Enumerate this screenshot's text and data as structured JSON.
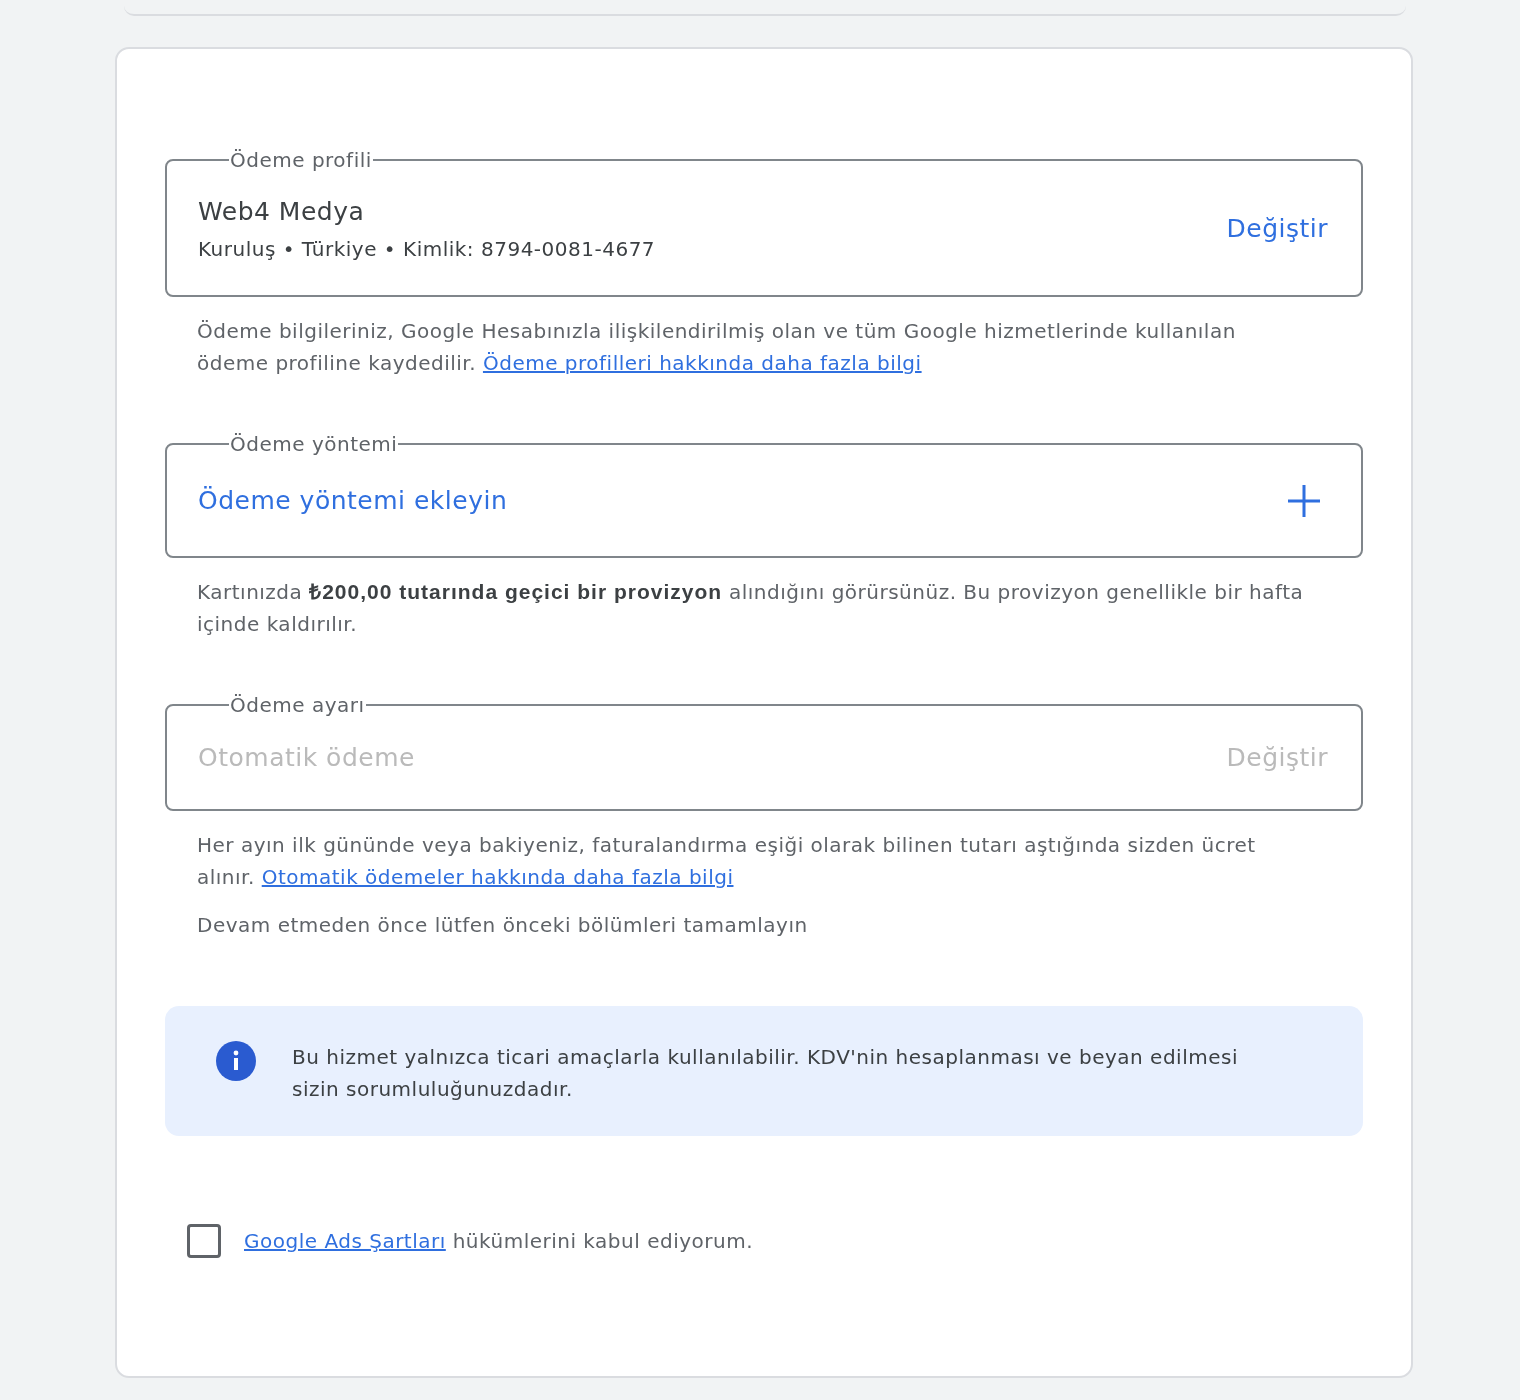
{
  "sections": [
    {
      "kind": "profile",
      "label": "Ödeme profili",
      "title": "Web4 Medya",
      "details": "Kuruluş • Türkiye • Kimlik: 8794-0081-4677",
      "action": "Değiştir",
      "disabled": false,
      "note": "Ödeme bilgileriniz, Google Hesabınızla ilişkilendirilmiş olan ve tüm Google hizmetlerinde kullanılan ödeme profiline kaydedilir.",
      "note_link": "Ödeme profilleri hakkında daha fazla bilgi"
    },
    {
      "kind": "add",
      "label": "Ödeme yöntemi",
      "title": "Ödeme yöntemi ekleyin",
      "disabled": false,
      "note": "Kartınızda **₺200,00 tutarında geçici bir provizyon** alındığını görürsünüz. Bu provizyon genellikle bir hafta içinde kaldırılır."
    },
    {
      "kind": "setting",
      "label": "Ödeme ayarı",
      "title": "Otomatik ödeme",
      "action": "Değiştir",
      "disabled": true,
      "note": "Her ayın ilk gününde veya bakiyeniz, faturalandırma eşiği olarak bilinen tutarı aştığında sizden ücret alınır.",
      "note_link": "Otomatik ödemeler hakkında daha fazla bilgi",
      "hint": "Devam etmeden önce lütfen önceki bölümleri tamamlayın"
    }
  ],
  "info": {
    "text": "Bu hizmet yalnızca ticari amaçlarla kullanılabilir. KDV'nin hesaplanması ve beyan edilmesi sizin sorumluluğunuzdadır."
  },
  "terms": {
    "checked": false,
    "link": "Google Ads Şartları",
    "text": "hükümlerini kabul ediyorum."
  }
}
